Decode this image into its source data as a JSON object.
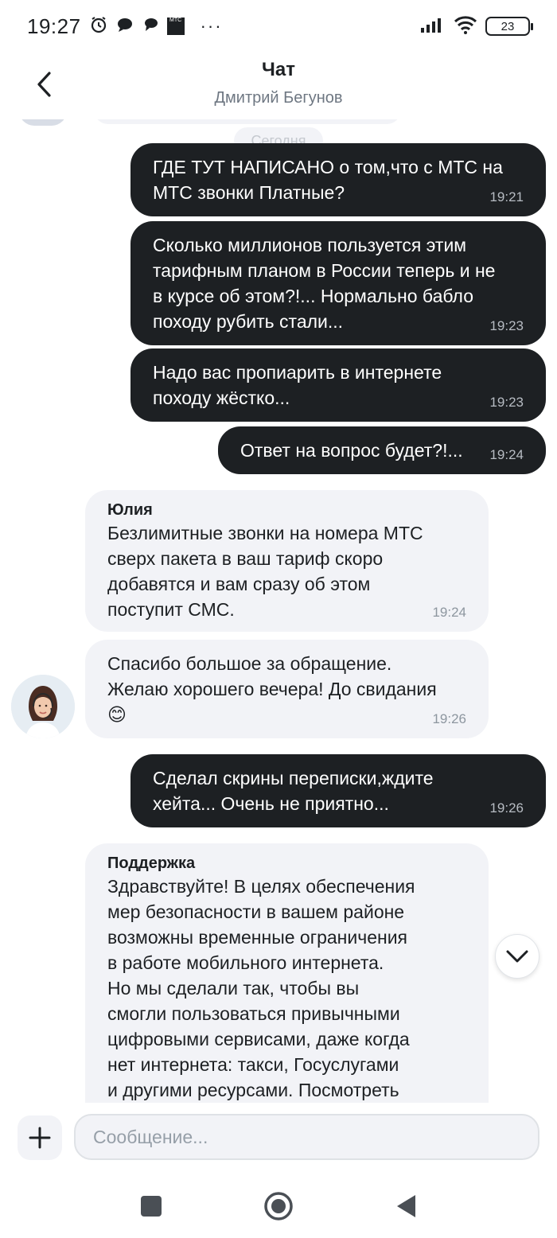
{
  "status_bar": {
    "time": "19:27",
    "battery": "23",
    "left_icons": [
      "alarm-icon",
      "chat-bubble-icon",
      "chat-bubbles-icon",
      "mts-app-icon"
    ],
    "more": "···",
    "mts_mini": "МТС"
  },
  "header": {
    "title": "Чат",
    "subtitle": "Дмитрий Бегунов"
  },
  "date_chip": "Сегодня",
  "messages": [
    {
      "direction": "out",
      "text": "ГДЕ ТУТ НАПИСАНО о том,что с МТС на\nМТС звонки Платные?",
      "time": "19:21"
    },
    {
      "direction": "out",
      "text": "Сколько миллионов пользуется этим\nтарифным планом в России теперь и не\nв курсе об этом?!... Нормально бабло\nпоходу рубить стали...",
      "time": "19:23"
    },
    {
      "direction": "out",
      "text": "Надо вас пропиарить в интернете\nпоходу жёстко...",
      "time": "19:23"
    },
    {
      "direction": "out",
      "text": "Ответ на вопрос будет?!...",
      "time": "19:24"
    },
    {
      "direction": "in",
      "sender": "Юлия",
      "text": "Безлимитные звонки на номера МТС\nсверх пакета в ваш тариф скоро\nдобавятся и вам сразу об этом\nпоступит СМС.",
      "time": "19:24"
    },
    {
      "direction": "in",
      "text": "Спасибо большое за обращение.\nЖелаю хорошего вечера! До свидания\n😊",
      "time": "19:26"
    },
    {
      "direction": "out",
      "text": "Сделал скрины переписки,ждите\nхейта... Очень не приятно...",
      "time": "19:26"
    },
    {
      "direction": "in",
      "sender": "Поддержка",
      "text": "Здравствуйте! В целях обеспечения\nмер безопасности в вашем районе\nвозможны временные ограничения\nв работе мобильного интернета.\nНо мы сделали так, чтобы вы\nсмогли пользоваться привычными\nцифровыми сервисами, даже когда\nнет интернета: такси, Госуслугами\nи другими ресурсами. Посмотреть"
    }
  ],
  "input": {
    "placeholder": "Сообщение..."
  },
  "colors": {
    "outgoing_bubble": "#1d2023",
    "incoming_bubble": "#f2f3f7",
    "secondary_text": "#6e7782"
  }
}
